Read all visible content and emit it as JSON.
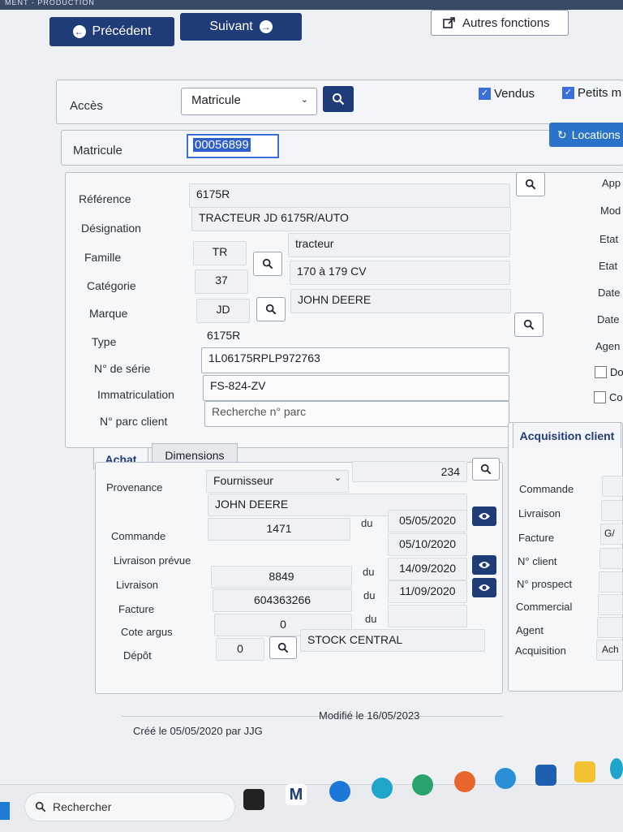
{
  "header": {
    "window_title_fragment": "MENT - PRODUCTION",
    "prev_label": "Précédent",
    "next_label": "Suivant",
    "more_label": "Autres fonctions"
  },
  "access": {
    "label": "Accès",
    "select_value": "Matricule",
    "chk_vendus": "Vendus",
    "chk_petits": "Petits m"
  },
  "matricule": {
    "label": "Matricule",
    "value": "00056899",
    "locations_label": "Locations"
  },
  "details": {
    "reference_label": "Référence",
    "reference": "6175R",
    "designation_label": "Désignation",
    "designation": "TRACTEUR JD 6175R/AUTO",
    "famille_label": "Famille",
    "famille_code": "TR",
    "famille_name": "tracteur",
    "categorie_label": "Catégorie",
    "categorie_code": "37",
    "categorie_name": "170 à 179 CV",
    "marque_label": "Marque",
    "marque_code": "JD",
    "marque_name": "JOHN DEERE",
    "type_label": "Type",
    "type": "6175R",
    "serie_label": "N° de série",
    "serie": "1L06175RPLP972763",
    "immat_label": "Immatriculation",
    "immat": "FS-824-ZV",
    "parc_label": "N° parc client",
    "parc_placeholder": "Recherche n° parc"
  },
  "right_labels": [
    "App",
    "Mod",
    "Etat",
    "Etat",
    "Date",
    "Date",
    "Agen"
  ],
  "right_checks": [
    "Do",
    "Co"
  ],
  "tabs": {
    "achat": "Achat",
    "dimensions": "Dimensions"
  },
  "achat": {
    "provenance_label": "Provenance",
    "provenance_value": "Fournisseur",
    "provenance_code": "234",
    "supplier_name": "JOHN DEERE",
    "commande_label": "Commande",
    "commande_value": "1471",
    "commande_date": "05/05/2020",
    "livraison_prevue_label": "Livraison prévue",
    "livraison_prevue_date": "05/10/2020",
    "livraison_label": "Livraison",
    "livraison_value": "8849",
    "livraison_date": "14/09/2020",
    "facture_label": "Facture",
    "facture_value": "604363266",
    "facture_date": "11/09/2020",
    "cote_label": "Cote argus",
    "cote_value": "0",
    "depot_label": "Dépôt",
    "depot_code": "0",
    "depot_name": "STOCK CENTRAL",
    "du": "du"
  },
  "acquisition": {
    "title": "Acquisition client",
    "labels": [
      "Commande",
      "Livraison",
      "Facture",
      "N° client",
      "N° prospect",
      "Commercial",
      "Agent",
      "Acquisition"
    ],
    "facture_fragment": "G/",
    "acquisition_fragment": "Ach"
  },
  "footer": {
    "created": "Créé le 05/05/2020 par JJG",
    "modified": "Modifié le 16/05/2023"
  },
  "taskbar": {
    "search_label": "Rechercher"
  },
  "colors": {
    "primary": "#1f3c78",
    "locations": "#2a73c9",
    "checkbox": "#3a6fd8"
  }
}
